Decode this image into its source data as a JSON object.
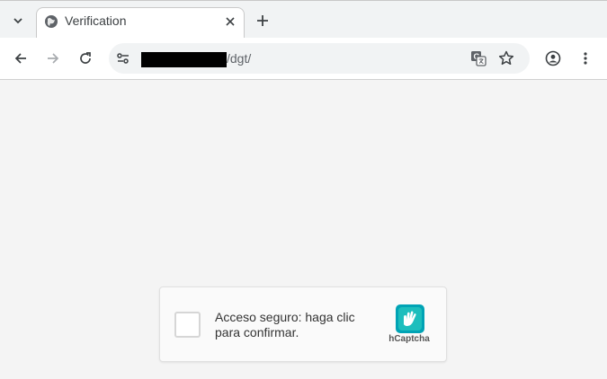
{
  "tab": {
    "title": "Verification"
  },
  "address_bar": {
    "url_suffix": "/dgt/"
  },
  "captcha": {
    "label": "Acceso seguro: haga clic para confirmar.",
    "brand": "hCaptcha"
  },
  "colors": {
    "hcaptcha_teal": "#00a3b5",
    "hcaptcha_green": "#34d6c2",
    "text": "#3c4043"
  },
  "icons": [
    "chevron-down-icon",
    "globe-icon",
    "close-icon",
    "plus-icon",
    "back-arrow-icon",
    "forward-arrow-icon",
    "reload-icon",
    "site-settings-icon",
    "translate-icon",
    "star-icon",
    "profile-icon",
    "menu-dots-icon",
    "hcaptcha-logo-icon"
  ]
}
